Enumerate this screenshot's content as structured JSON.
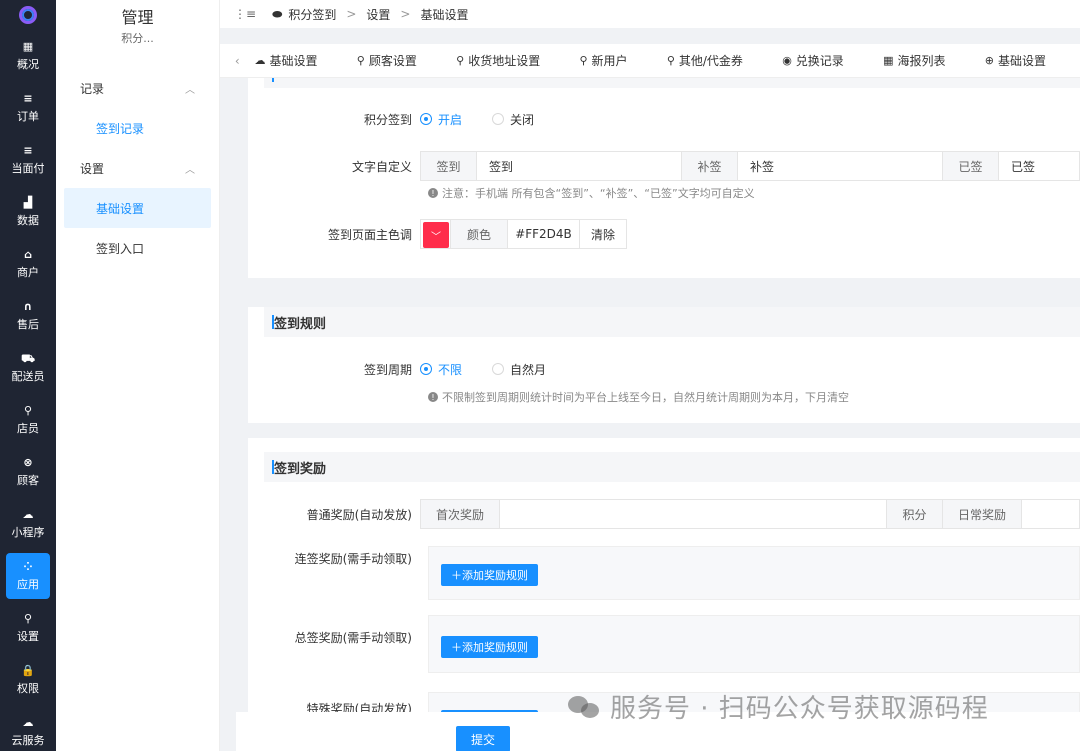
{
  "rail": {
    "items": [
      {
        "icon": "▦",
        "label": "概况"
      },
      {
        "icon": "≡",
        "label": "订单"
      },
      {
        "icon": "≡",
        "label": "当面付"
      },
      {
        "icon": "▟",
        "label": "数据"
      },
      {
        "icon": "⌂",
        "label": "商户"
      },
      {
        "icon": "∩",
        "label": "售后"
      },
      {
        "icon": "⛟",
        "label": "配送员"
      },
      {
        "icon": "⚲",
        "label": "店员"
      },
      {
        "icon": "⊗",
        "label": "顾客"
      },
      {
        "icon": "☁",
        "label": "小程序"
      },
      {
        "icon": "⁘",
        "label": "应用"
      },
      {
        "icon": "⚲",
        "label": "设置"
      },
      {
        "icon": "🔒",
        "label": "权限"
      },
      {
        "icon": "☁",
        "label": "云服务"
      }
    ]
  },
  "submenu": {
    "title": "管理",
    "subtitle": "积分...",
    "group1": "记录",
    "item1": "签到记录",
    "group2": "设置",
    "item2": "基础设置",
    "item3": "签到入口"
  },
  "breadcrumb": {
    "c1": "积分签到",
    "c2": "设置",
    "c3": "基础设置"
  },
  "tabs": [
    {
      "icon": "☁",
      "label": "基础设置"
    },
    {
      "icon": "⚲",
      "label": "顾客设置"
    },
    {
      "icon": "⚲",
      "label": "收货地址设置"
    },
    {
      "icon": "⚲",
      "label": "新用户"
    },
    {
      "icon": "⚲",
      "label": "其他/代金券"
    },
    {
      "icon": "◉",
      "label": "兑换记录"
    },
    {
      "icon": "▦",
      "label": "海报列表"
    },
    {
      "icon": "⊕",
      "label": "基础设置"
    }
  ],
  "basic": {
    "signin_label": "积分签到",
    "opt_on": "开启",
    "opt_off": "关闭",
    "text_label": "文字自定义",
    "t1_addon": "签到",
    "t1_value": "签到",
    "t2_addon": "补签",
    "t2_value": "补签",
    "t3_addon": "已签",
    "t3_value": "已签",
    "text_tip": "注意：手机端 所有包含“签到”、“补签”、“已签”文字均可自定义",
    "color_label": "签到页面主色调",
    "color_addon": "颜色",
    "color_value": "#FF2D4B",
    "color_clear": "清除"
  },
  "rules": {
    "title": "签到规则",
    "period_label": "签到周期",
    "opt_unlimited": "不限",
    "opt_month": "自然月",
    "tip": "不限制签到周期则统计时间为平台上线至今日，自然月统计周期则为本月，下月清空"
  },
  "rewards": {
    "title": "签到奖励",
    "normal_label": "普通奖励(自动发放)",
    "first_addon": "首次奖励",
    "points_addon": "积分",
    "daily_addon": "日常奖励",
    "continuous_label": "连签奖励(需手动领取)",
    "total_label": "总签奖励(需手动领取)",
    "special_label": "特殊奖励(自动发放)",
    "add_rule": "＋添加奖励规则"
  },
  "footer": {
    "submit": "提交"
  },
  "watermark": "服务号 · 扫码公众号获取源码程",
  "colors": {
    "accent": "#1890ff",
    "rail_bg": "#1f2533",
    "theme_color": "#FF2D4B"
  }
}
